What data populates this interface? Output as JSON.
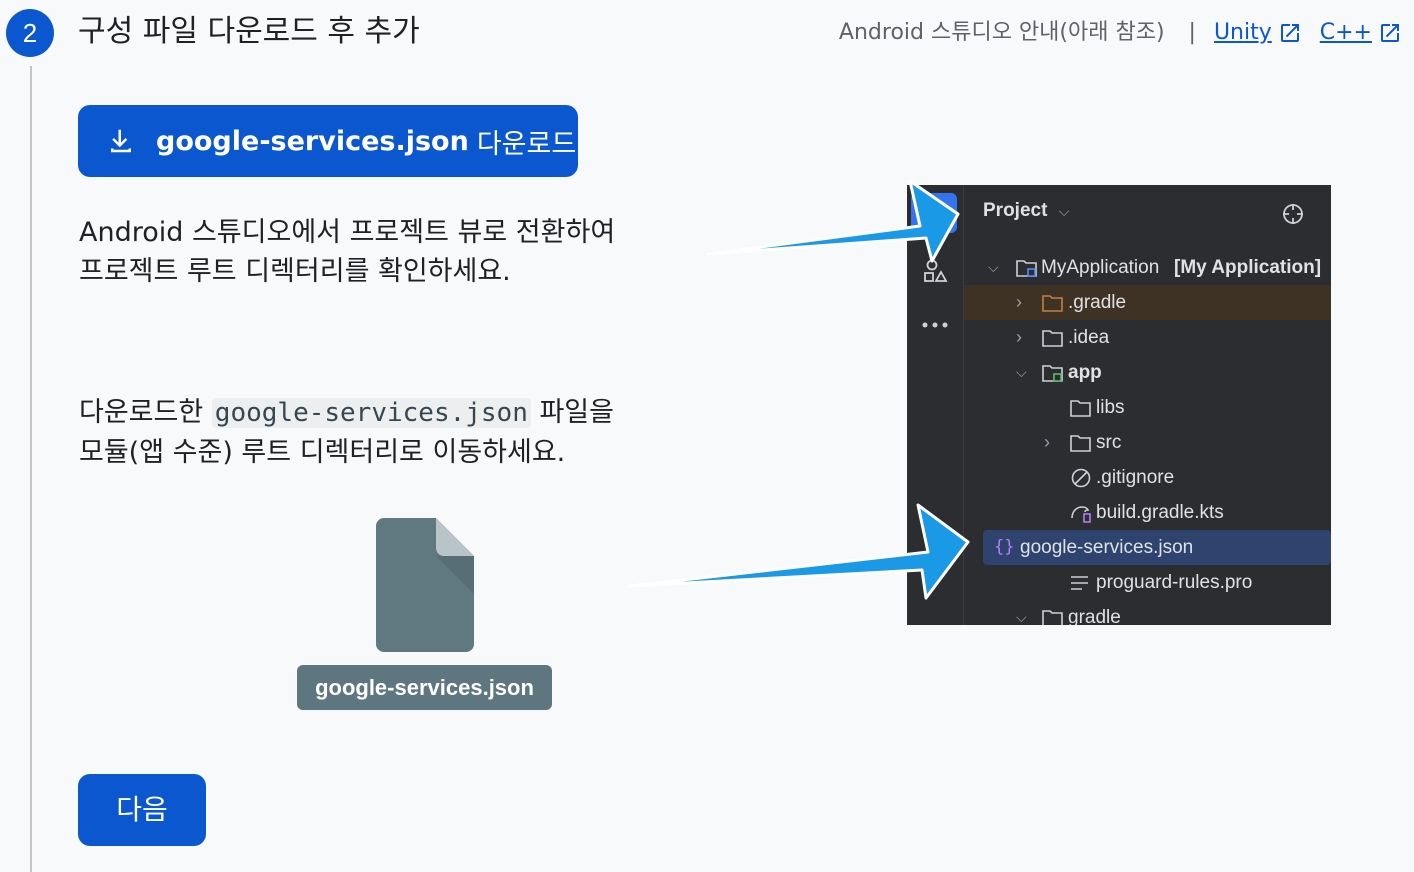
{
  "step": {
    "number": "2",
    "title": "구성 파일 다운로드 후 추가"
  },
  "header_links": {
    "android_guide": "Android 스튜디오 안내(아래 참조)",
    "separator": "|",
    "unity_label": "Unity",
    "cpp_label": "C++"
  },
  "download_button": {
    "filename": "google-services.json",
    "action": "다운로드"
  },
  "instructions": {
    "line1": "Android 스튜디오에서 프로젝트 뷰로 전환하여",
    "line2": "프로젝트 루트 디렉터리를 확인하세요.",
    "line3_prefix": "다운로드한",
    "line3_code": "google-services.json",
    "line3_suffix": "파일을",
    "line4": "모듈(앱 수준) 루트 디렉터리로 이동하세요."
  },
  "file_label": "google-services.json",
  "next_button": "다음",
  "ide": {
    "header": "Project",
    "root_name": "MyApplication",
    "root_bracket": "[My Application]",
    "items": {
      "gradle_hidden": ".gradle",
      "idea": ".idea",
      "app": "app",
      "libs": "libs",
      "src": "src",
      "gitignore": ".gitignore",
      "build_gradle": "build.gradle.kts",
      "google_services": "google-services.json",
      "proguard": "proguard-rules.pro",
      "gradle": "gradle"
    }
  },
  "colors": {
    "primary": "#0b57d0",
    "file_gray": "#5e7680",
    "arrow_blue": "#1a9ae6",
    "ide_bg": "#2b2d30",
    "ide_selection": "#2e436e"
  }
}
